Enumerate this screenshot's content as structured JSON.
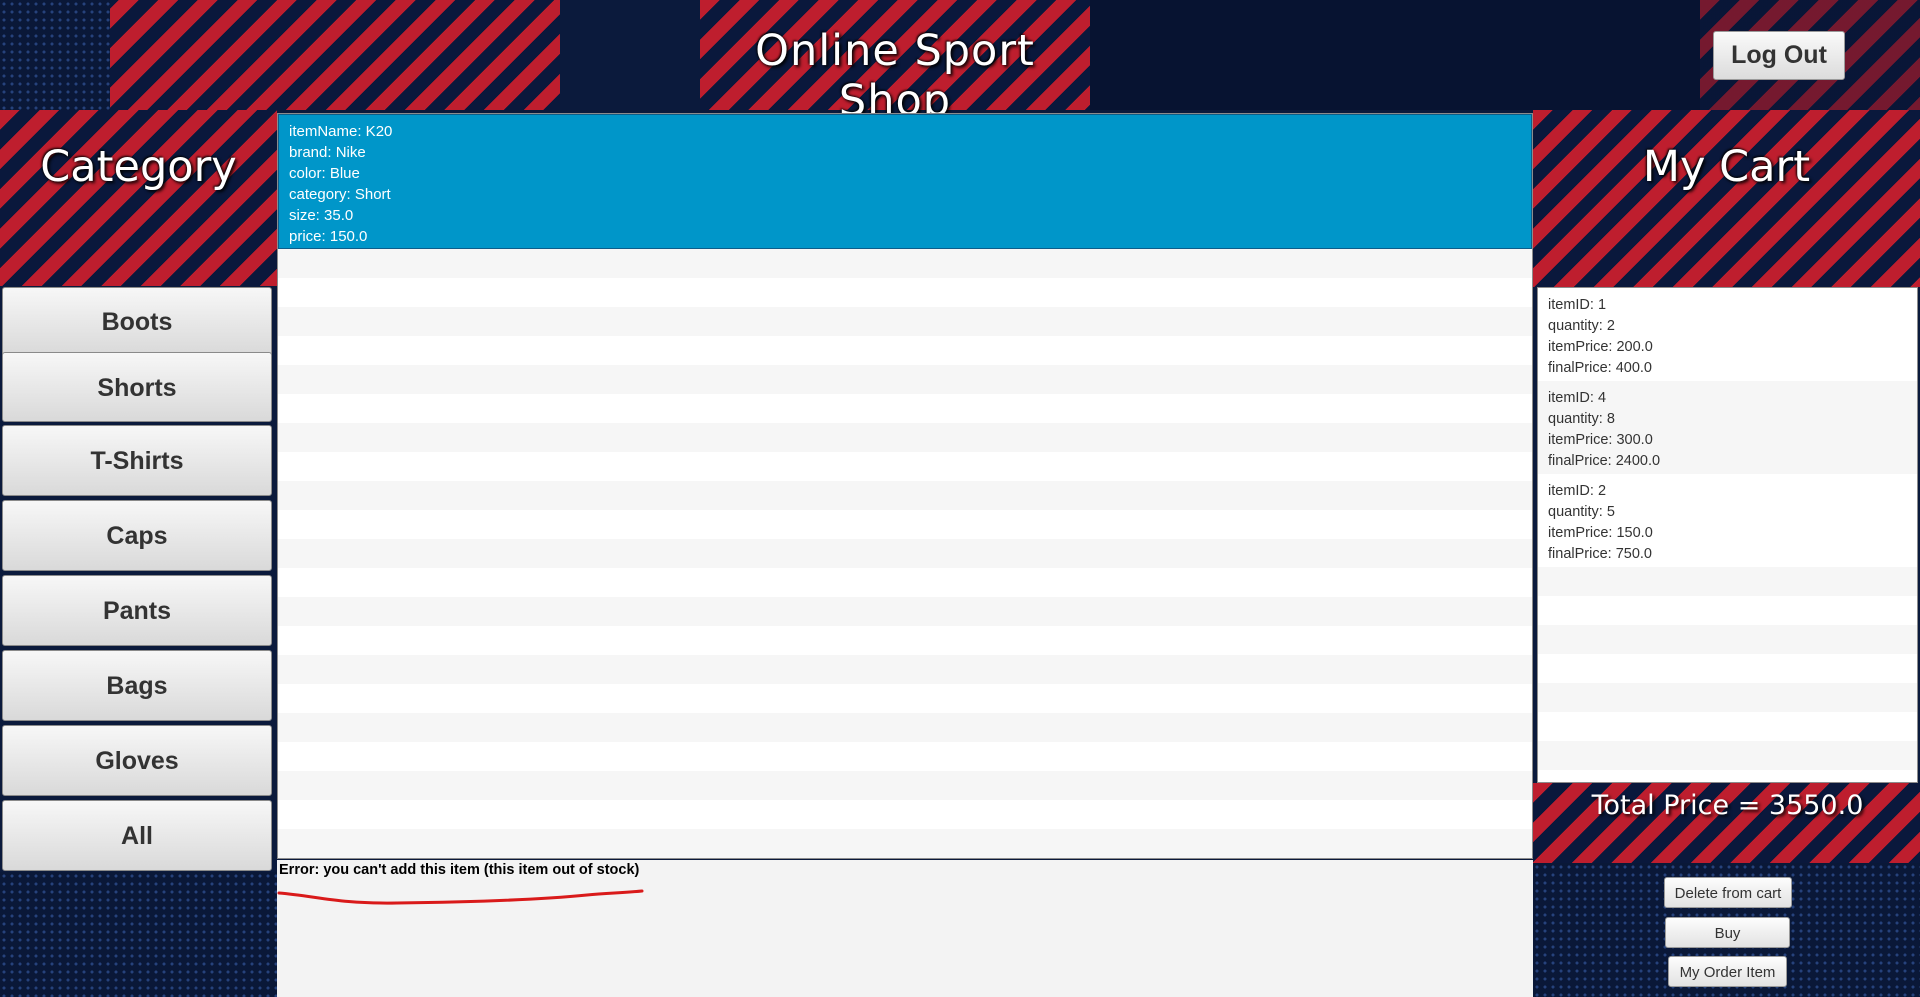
{
  "header": {
    "title": "Online Sport Shop",
    "logout_label": "Log Out"
  },
  "sidebar": {
    "heading": "Category",
    "categories": [
      "Boots",
      "Shorts",
      "T-Shirts",
      "Caps",
      "Pants",
      "Bags",
      "Gloves",
      "All"
    ]
  },
  "items": {
    "selected": {
      "lines": [
        "itemName: K20",
        "brand: Nike",
        "color: Blue",
        "category: Short",
        "size: 35.0",
        "price: 150.0"
      ]
    }
  },
  "cart": {
    "heading": "My Cart",
    "entries": [
      {
        "lines": [
          "itemID: 1",
          "quantity: 2",
          "itemPrice: 200.0",
          "finalPrice: 400.0"
        ]
      },
      {
        "lines": [
          "itemID: 4",
          "quantity: 8",
          "itemPrice: 300.0",
          "finalPrice: 2400.0"
        ]
      },
      {
        "lines": [
          "itemID: 2",
          "quantity: 5",
          "itemPrice: 150.0",
          "finalPrice: 750.0"
        ]
      }
    ],
    "total_label": "Total Price  =  3550.0"
  },
  "status": {
    "error_text": "Error: you can't add this item (this item out of stock)"
  },
  "actions": {
    "delete_label": "Delete from cart",
    "buy_label": "Buy",
    "orders_label": "My Order Item"
  },
  "colors": {
    "selection": "#0096c9",
    "error_underline": "#d91a1a",
    "accent_red": "#c81e2d",
    "navy": "#0b1a3c"
  }
}
